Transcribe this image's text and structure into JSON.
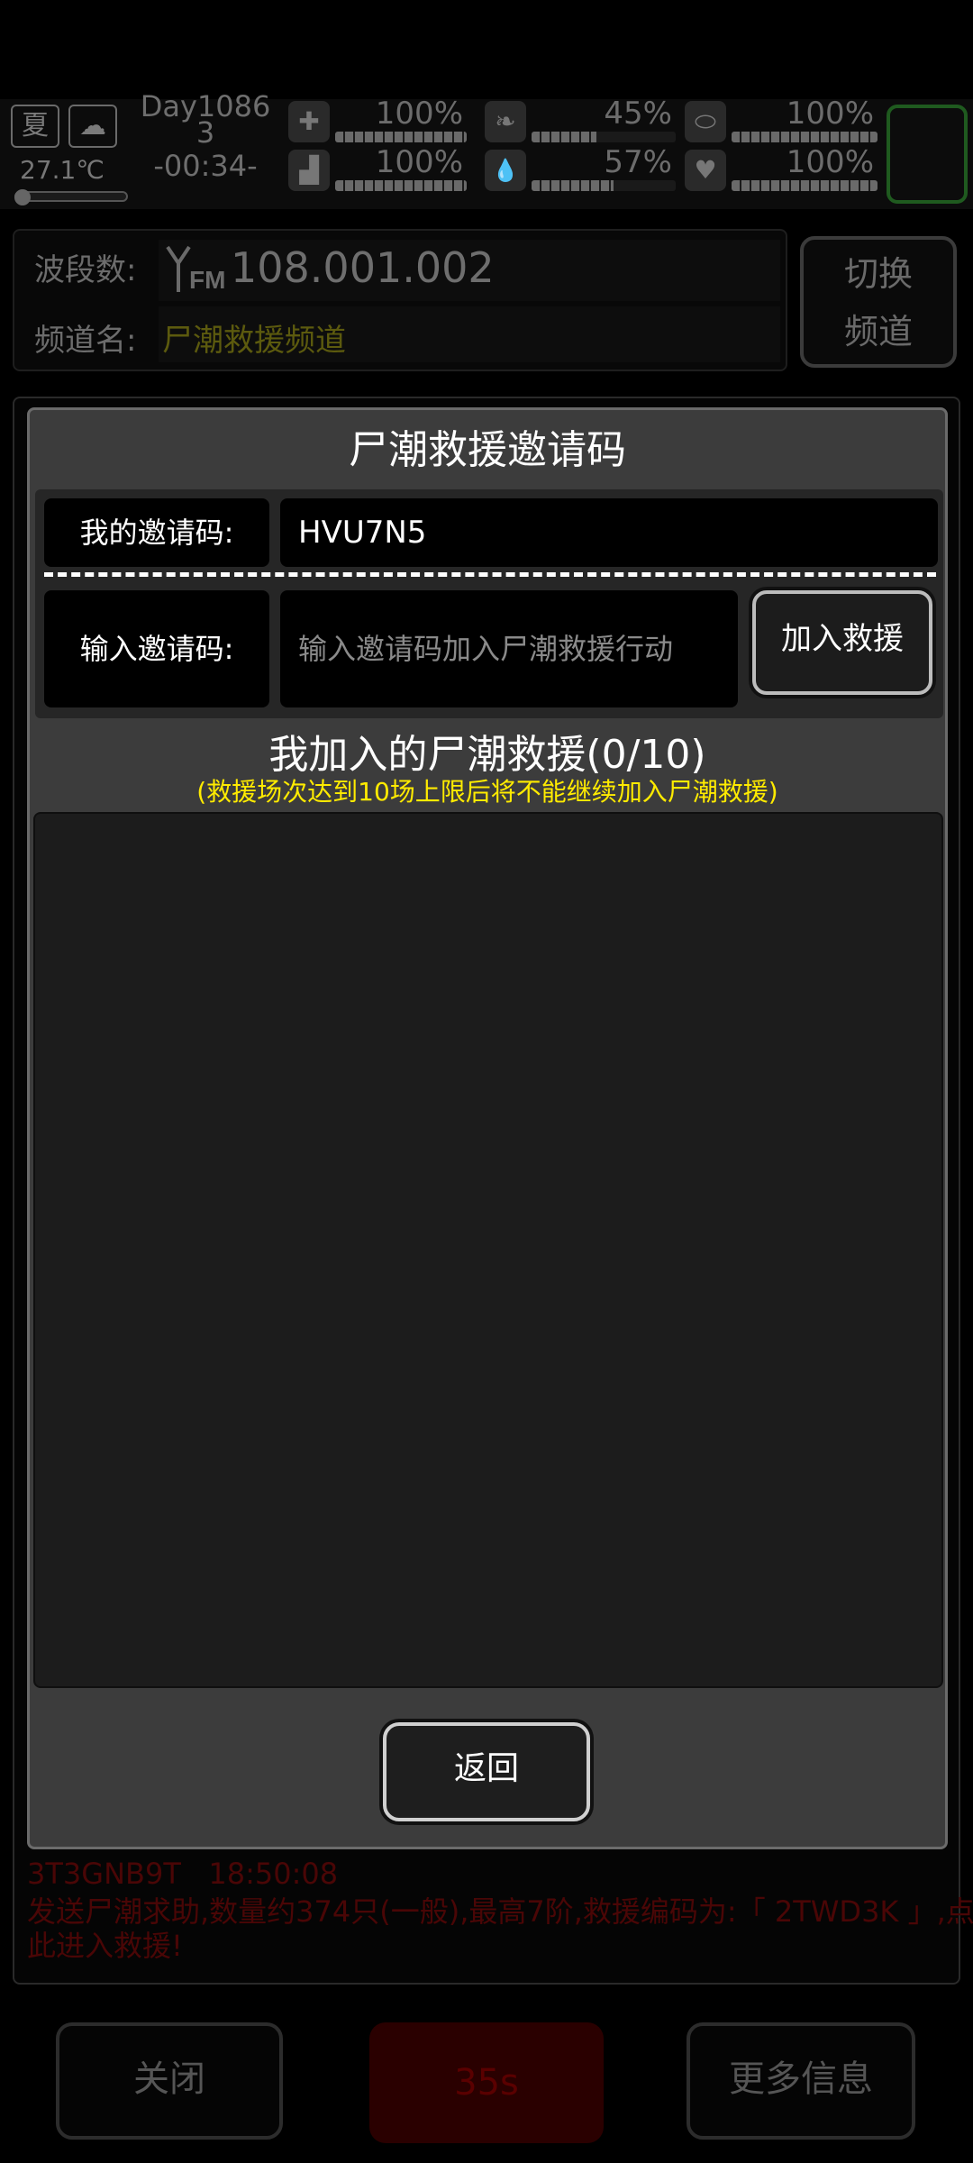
{
  "hud": {
    "season": "夏",
    "weather_icon": "cloud-rain-icon",
    "temperature": "27.1℃",
    "day_line1": "Day1086",
    "day_line2": "3",
    "time": "-00:34-",
    "stats": [
      {
        "icon": "medkit-icon",
        "glyph": "✚",
        "value": "100%",
        "level": 1.0
      },
      {
        "icon": "stomach-icon",
        "glyph": "❧",
        "value": "45%",
        "level": 0.45
      },
      {
        "icon": "pill-icon",
        "glyph": "⬭",
        "value": "100%",
        "level": 1.0
      },
      {
        "icon": "boot-icon",
        "glyph": "▟",
        "value": "100%",
        "level": 1.0
      },
      {
        "icon": "water-drop-icon",
        "glyph": "💧",
        "value": "57%",
        "level": 0.57
      },
      {
        "icon": "heart-icon",
        "glyph": "♥",
        "value": "100%",
        "level": 1.0
      }
    ]
  },
  "radio": {
    "freq_label": "波段数:",
    "freq_value": "108.001.002",
    "channel_label": "频道名:",
    "channel_value": "尸潮救援频道",
    "switch_line1": "切换",
    "switch_line2": "频道"
  },
  "chat": {
    "sender": "3T3GNB9T",
    "time": "18:50:08",
    "line1": "发送尸潮求助,数量约374只(一般),最高7阶,救援编码为:「 2TWD3K 」,点",
    "line2": "此进入救援!"
  },
  "dialog": {
    "title": "尸潮救援邀请码",
    "my_code_label": "我的邀请码:",
    "my_code_value": "HVU7N5",
    "input_label": "输入邀请码:",
    "input_placeholder": "输入邀请码加入尸潮救援行动",
    "join_button": "加入救援",
    "list_title": "我加入的尸潮救援(0/10)",
    "list_note": "(救援场次达到10场上限后将不能继续加入尸潮救援)",
    "back_button": "返回"
  },
  "bottom": {
    "close_label": "关闭",
    "timer_label": "35s",
    "more_label": "更多信息"
  }
}
